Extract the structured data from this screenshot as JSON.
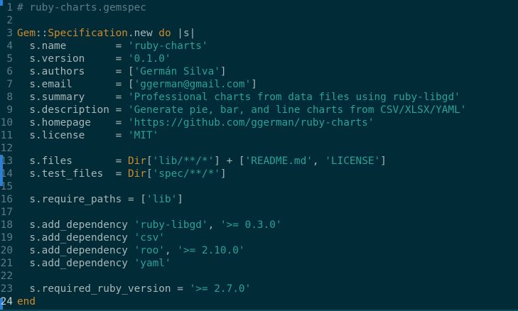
{
  "editor": {
    "lines": [
      {
        "n": "1",
        "parts": [
          {
            "t": "cmt",
            "v": "# ruby-charts.gemspec"
          }
        ]
      },
      {
        "n": "2",
        "parts": []
      },
      {
        "n": "3",
        "parts": [
          {
            "t": "cls",
            "v": "Gem"
          },
          {
            "t": "txt",
            "v": "::"
          },
          {
            "t": "cls",
            "v": "Specification"
          },
          {
            "t": "txt",
            "v": ".new "
          },
          {
            "t": "kw",
            "v": "do"
          },
          {
            "t": "txt",
            "v": " |s|"
          }
        ]
      },
      {
        "n": "4",
        "parts": [
          {
            "t": "txt",
            "v": "  s.name        = "
          },
          {
            "t": "str",
            "v": "'ruby-charts'"
          }
        ]
      },
      {
        "n": "5",
        "parts": [
          {
            "t": "txt",
            "v": "  s.version     = "
          },
          {
            "t": "str",
            "v": "'0.1.0'"
          }
        ]
      },
      {
        "n": "6",
        "parts": [
          {
            "t": "txt",
            "v": "  s.authors     = ["
          },
          {
            "t": "str",
            "v": "'Germán Silva'"
          },
          {
            "t": "txt",
            "v": "]"
          }
        ]
      },
      {
        "n": "7",
        "parts": [
          {
            "t": "txt",
            "v": "  s.email       = ["
          },
          {
            "t": "str",
            "v": "'ggerman@gmail.com'"
          },
          {
            "t": "txt",
            "v": "]"
          }
        ]
      },
      {
        "n": "8",
        "parts": [
          {
            "t": "txt",
            "v": "  s.summary     = "
          },
          {
            "t": "str",
            "v": "'Professional charts from data files using ruby-libgd'"
          }
        ]
      },
      {
        "n": "9",
        "parts": [
          {
            "t": "txt",
            "v": "  s.description = "
          },
          {
            "t": "str",
            "v": "'Generate pie, bar, and line charts from CSV/XLSX/YAML'"
          }
        ]
      },
      {
        "n": "10",
        "parts": [
          {
            "t": "txt",
            "v": "  s.homepage    = "
          },
          {
            "t": "str",
            "v": "'https://github.com/ggerman/ruby-charts'"
          }
        ]
      },
      {
        "n": "11",
        "parts": [
          {
            "t": "txt",
            "v": "  s.license     = "
          },
          {
            "t": "str",
            "v": "'MIT'"
          }
        ]
      },
      {
        "n": "12",
        "parts": []
      },
      {
        "n": "13",
        "parts": [
          {
            "t": "txt",
            "v": "  s.files       = "
          },
          {
            "t": "cls",
            "v": "Dir"
          },
          {
            "t": "txt",
            "v": "["
          },
          {
            "t": "str",
            "v": "'lib/**/*'"
          },
          {
            "t": "txt",
            "v": "] + ["
          },
          {
            "t": "str",
            "v": "'README.md'"
          },
          {
            "t": "txt",
            "v": ", "
          },
          {
            "t": "str",
            "v": "'LICENSE'"
          },
          {
            "t": "txt",
            "v": "]"
          }
        ]
      },
      {
        "n": "14",
        "parts": [
          {
            "t": "txt",
            "v": "  s.test_files  = "
          },
          {
            "t": "cls",
            "v": "Dir"
          },
          {
            "t": "txt",
            "v": "["
          },
          {
            "t": "str",
            "v": "'spec/**/*'"
          },
          {
            "t": "txt",
            "v": "]"
          }
        ]
      },
      {
        "n": "15",
        "parts": []
      },
      {
        "n": "16",
        "parts": [
          {
            "t": "txt",
            "v": "  s.require_paths = ["
          },
          {
            "t": "str",
            "v": "'lib'"
          },
          {
            "t": "txt",
            "v": "]"
          }
        ]
      },
      {
        "n": "17",
        "parts": []
      },
      {
        "n": "18",
        "parts": [
          {
            "t": "txt",
            "v": "  s.add_dependency "
          },
          {
            "t": "str",
            "v": "'ruby-libgd'"
          },
          {
            "t": "txt",
            "v": ", "
          },
          {
            "t": "str",
            "v": "'>= 0.3.0'"
          }
        ]
      },
      {
        "n": "19",
        "parts": [
          {
            "t": "txt",
            "v": "  s.add_dependency "
          },
          {
            "t": "str",
            "v": "'csv'"
          }
        ]
      },
      {
        "n": "20",
        "parts": [
          {
            "t": "txt",
            "v": "  s.add_dependency "
          },
          {
            "t": "str",
            "v": "'roo'"
          },
          {
            "t": "txt",
            "v": ", "
          },
          {
            "t": "str",
            "v": "'>= 2.10.0'"
          }
        ]
      },
      {
        "n": "21",
        "parts": [
          {
            "t": "txt",
            "v": "  s.add_dependency "
          },
          {
            "t": "str",
            "v": "'yaml'"
          }
        ]
      },
      {
        "n": "22",
        "parts": []
      },
      {
        "n": "23",
        "parts": [
          {
            "t": "txt",
            "v": "  s.required_ruby_version = "
          },
          {
            "t": "str",
            "v": "'>= 2.7.0'"
          }
        ]
      },
      {
        "n": "24",
        "parts": [
          {
            "t": "kw",
            "v": "end"
          }
        ]
      }
    ],
    "current_line": "24"
  },
  "colors": {
    "background": "#012b36",
    "keyword": "#d08a2a",
    "string": "#2aa198",
    "comment": "#5f7c86",
    "text": "#a8b6b8",
    "line_number": "#5f7c86",
    "edge_marker": "#2b7fd6"
  }
}
